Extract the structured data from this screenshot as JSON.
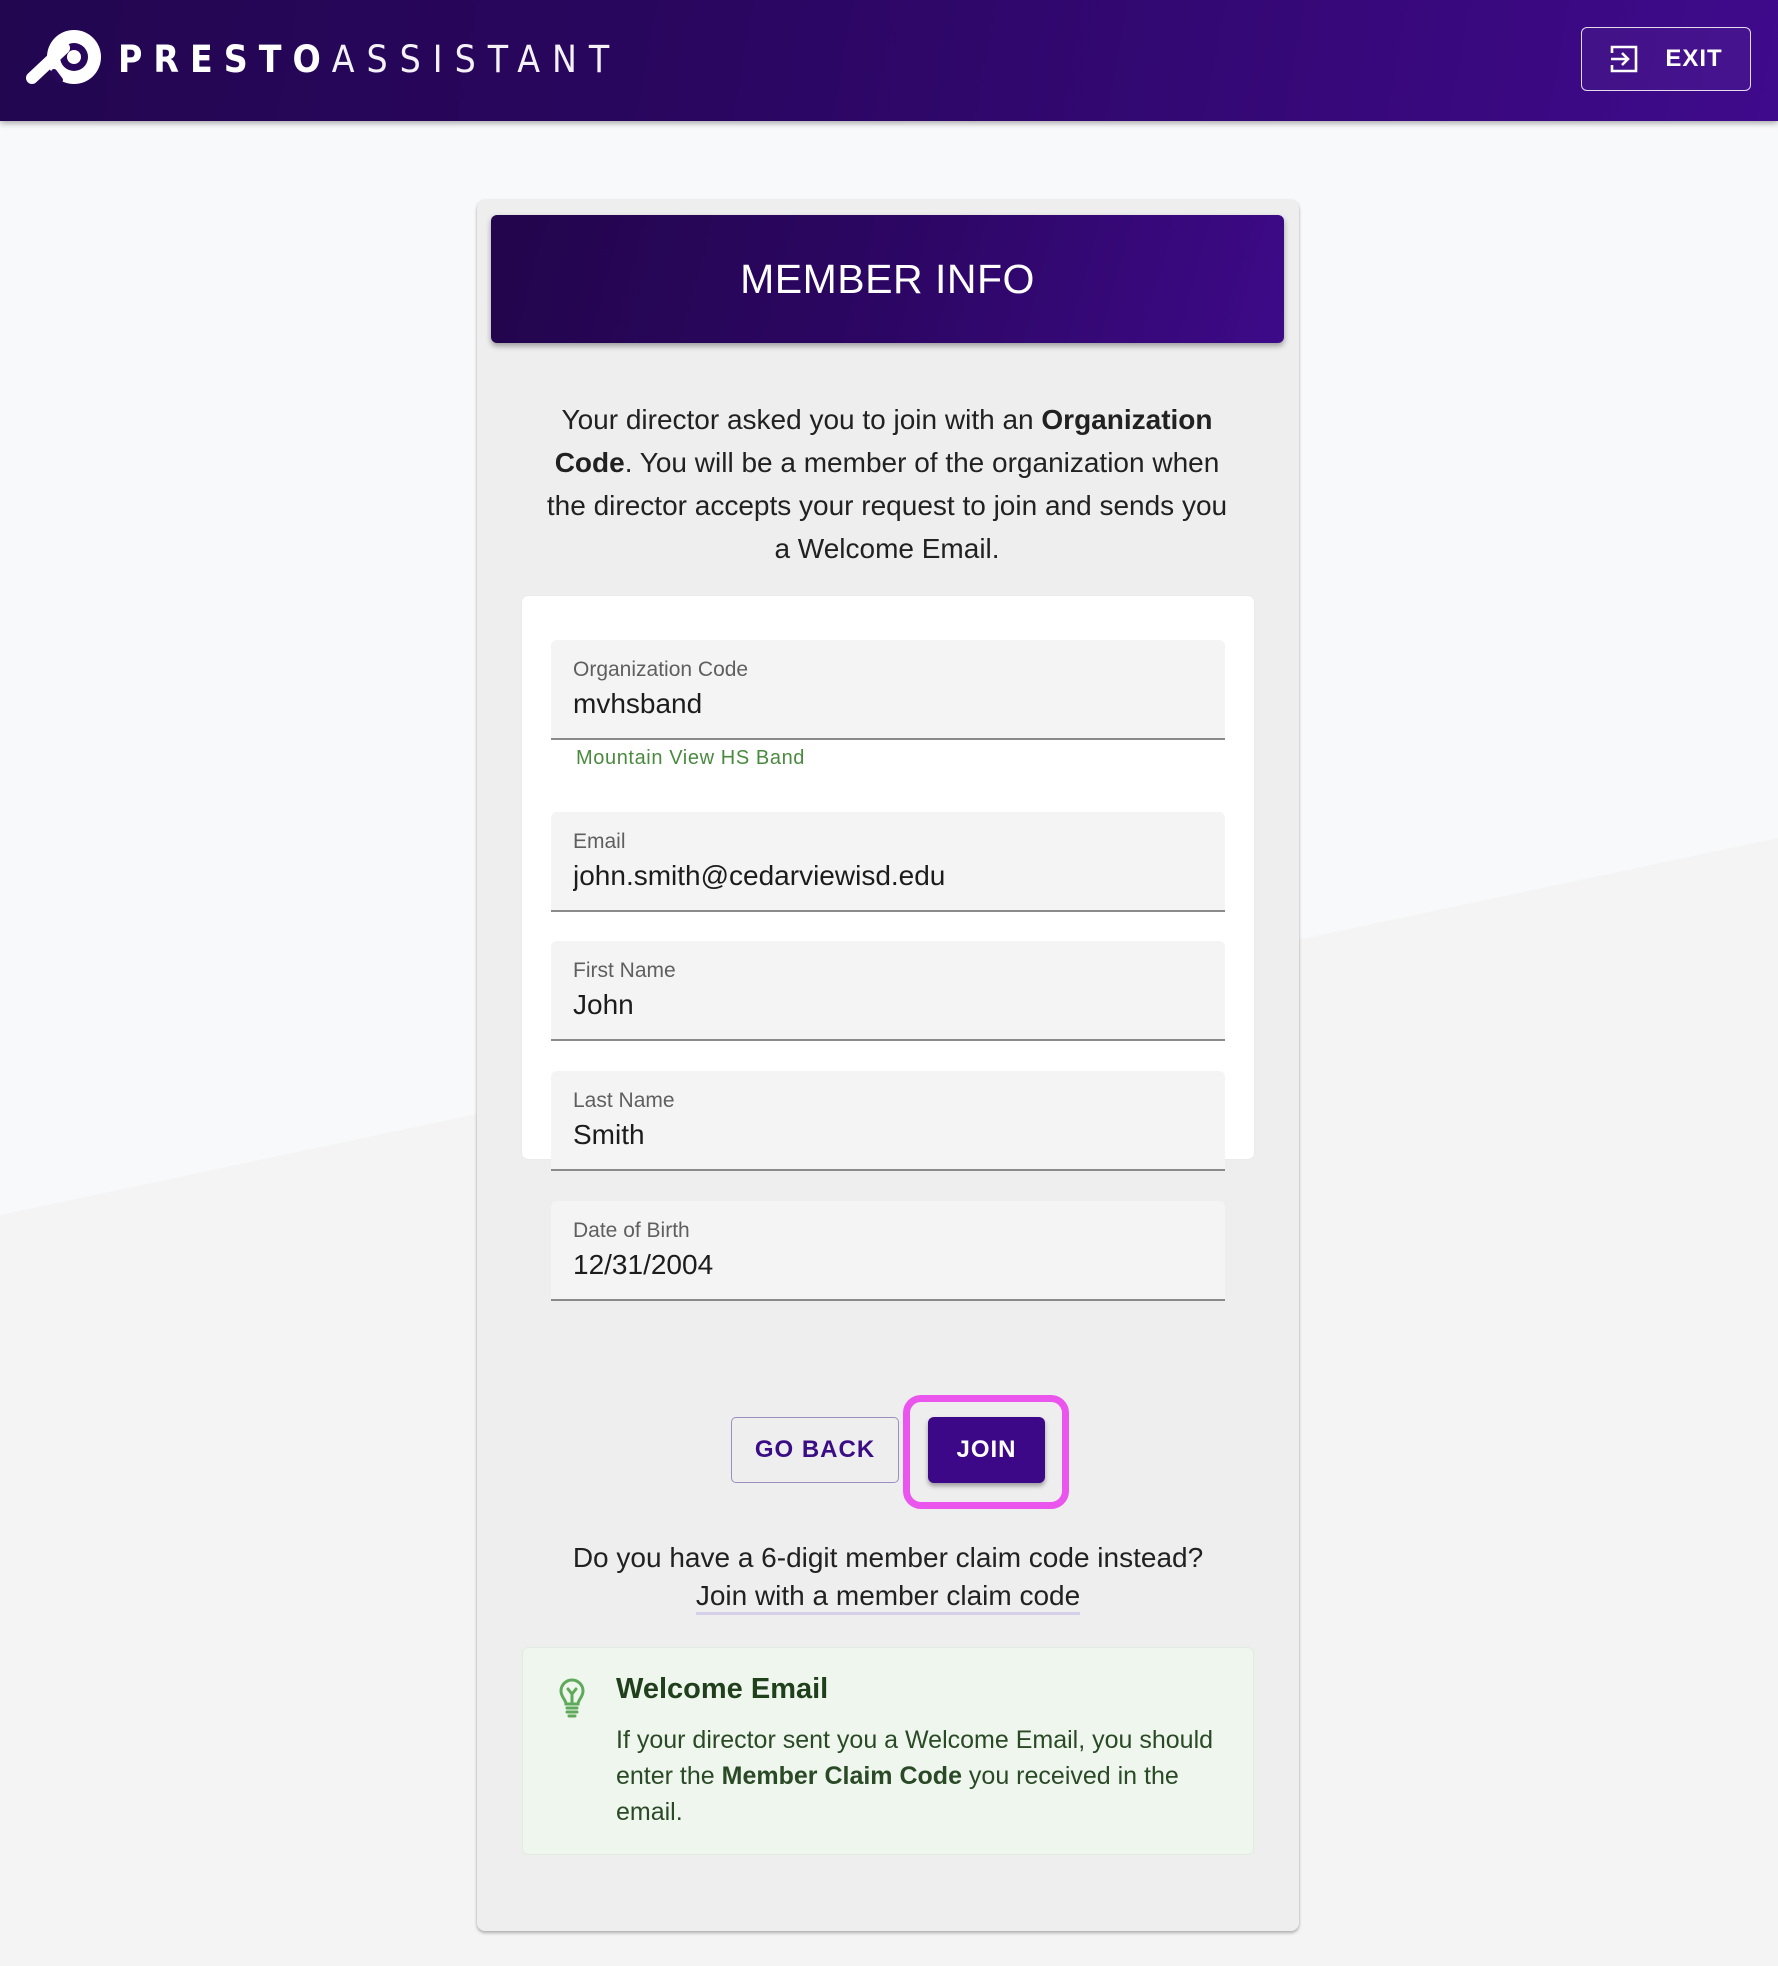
{
  "app": {
    "brand_bold": "PRESTO",
    "brand_light": "ASSISTANT",
    "exit_label": "EXIT"
  },
  "card": {
    "title": "MEMBER INFO",
    "intro": {
      "part1": "Your director asked you to join with an ",
      "bold": "Organization Code",
      "part2": ". You will be a member of the organization when the director accepts your request to join and sends you a Welcome Email."
    },
    "form": {
      "fields": [
        {
          "label": "Organization Code",
          "value": "mvhsband",
          "helper": "Mountain View HS Band"
        },
        {
          "label": "Email",
          "value": "john.smith@cedarviewisd.edu"
        },
        {
          "label": "First Name",
          "value": "John"
        },
        {
          "label": "Last Name",
          "value": "Smith"
        },
        {
          "label": "Date of Birth",
          "value": "12/31/2004"
        }
      ]
    },
    "buttons": {
      "go_back": "GO BACK",
      "join": "JOIN"
    },
    "claim": {
      "question": "Do you have a 6-digit member claim code instead?",
      "link": "Join with a member claim code"
    },
    "alert": {
      "icon": "lightbulb-icon",
      "title": "Welcome Email",
      "part1": "If your director sent you a Welcome Email, you should enter the ",
      "bold": "Member Claim Code",
      "part2": " you received in the email."
    }
  },
  "colors": {
    "brand_purple": "#3d0888",
    "header_dark": "#22054c",
    "highlight_magenta": "#ea55ee",
    "helper_green": "#4a8a3f",
    "alert_bg": "#eef6ee"
  }
}
